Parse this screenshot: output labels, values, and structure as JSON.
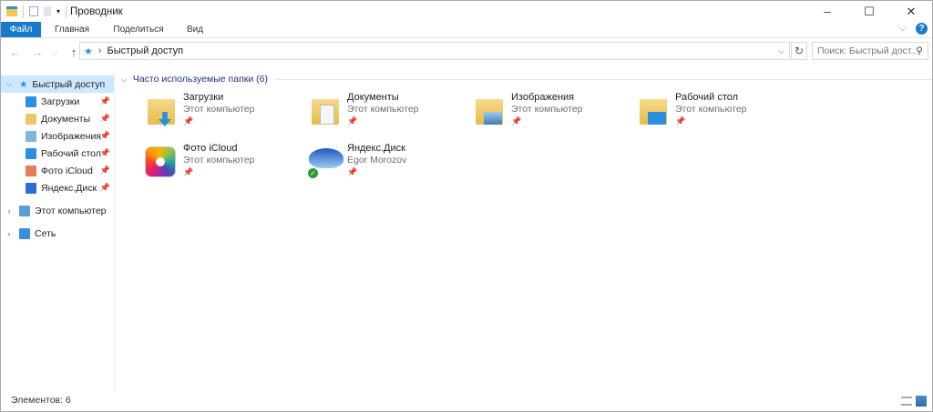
{
  "window": {
    "title": "Проводник",
    "minimize": "–",
    "maximize": "☐",
    "close": "✕"
  },
  "ribbon": {
    "tabs": [
      "Файл",
      "Главная",
      "Поделиться",
      "Вид"
    ],
    "expand": "⌵",
    "help": "?"
  },
  "nav": {
    "back": "←",
    "forward": "→",
    "recent": "⌵",
    "up": "↑",
    "breadcrumb": "Быстрый доступ",
    "sep": "›",
    "refresh": "↻",
    "search_placeholder": "Поиск: Быстрый дост...",
    "search_icon": "⚲"
  },
  "sidebar": {
    "quick_access": "Быстрый доступ",
    "pinned": [
      {
        "label": "Загрузки",
        "color": "#2b8ee0"
      },
      {
        "label": "Документы",
        "color": "#e9c86a"
      },
      {
        "label": "Изображения",
        "color": "#7fb6e0"
      },
      {
        "label": "Рабочий стол",
        "color": "#2b8ee0"
      },
      {
        "label": "Фото iCloud",
        "color": "#e87b5a"
      },
      {
        "label": "Яндекс.Диск",
        "color": "#2c6fd6"
      }
    ],
    "this_pc": "Этот компьютер",
    "network": "Сеть",
    "pin": "📌"
  },
  "main": {
    "group_title": "Часто используемые папки (6)",
    "items": [
      {
        "name": "Загрузки",
        "sub": "Этот компьютер"
      },
      {
        "name": "Документы",
        "sub": "Этот компьютер"
      },
      {
        "name": "Изображения",
        "sub": "Этот компьютер"
      },
      {
        "name": "Рабочий стол",
        "sub": "Этот компьютер"
      },
      {
        "name": "Фото iCloud",
        "sub": "Этот компьютер"
      },
      {
        "name": "Яндекс.Диск",
        "sub": "Egor Morozov"
      }
    ],
    "pin": "📌"
  },
  "status": {
    "count": "Элементов: 6"
  }
}
